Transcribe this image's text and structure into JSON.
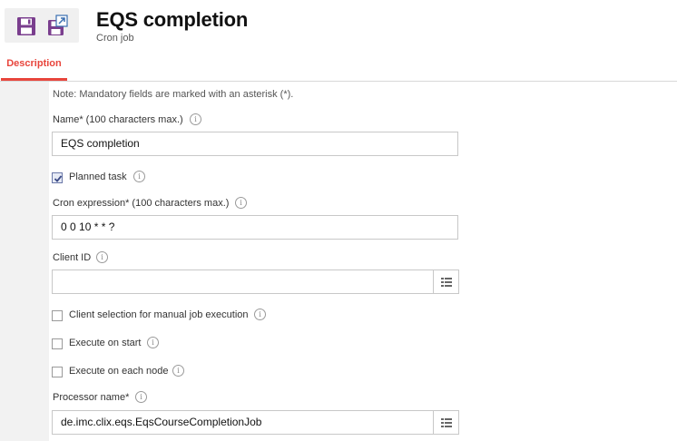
{
  "header": {
    "title": "EQS completion",
    "subtitle": "Cron job",
    "save_icon": "save-icon",
    "save_as_icon": "save-as-icon"
  },
  "tabs": [
    {
      "label": "Description",
      "active": true
    }
  ],
  "form": {
    "note": "Note: Mandatory fields are marked with an asterisk (*).",
    "name": {
      "label": "Name* (100 characters max.)",
      "value": "EQS completion"
    },
    "planned_task": {
      "label": "Planned task",
      "checked": true
    },
    "cron_expression": {
      "label": "Cron expression* (100 characters max.)",
      "value": "0 0 10 * * ?"
    },
    "client_id": {
      "label": "Client ID",
      "value": ""
    },
    "client_selection": {
      "label": "Client selection for manual job execution",
      "checked": false
    },
    "execute_on_start": {
      "label": "Execute on start",
      "checked": false
    },
    "execute_on_each_node": {
      "label": "Execute on each node",
      "checked": false
    },
    "processor_name": {
      "label": "Processor name*",
      "value": "de.imc.clix.eqs.EqsCourseCompletionJob"
    }
  },
  "colors": {
    "accent": "#e8453c",
    "icon_purple": "#7a3e8e",
    "icon_blue": "#3a6fb0"
  }
}
